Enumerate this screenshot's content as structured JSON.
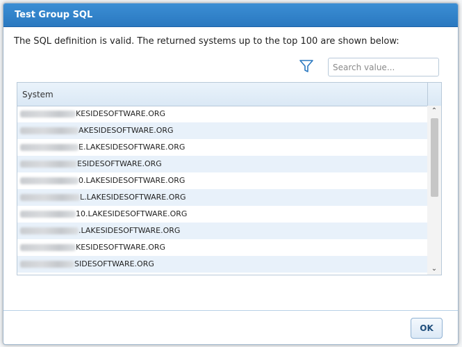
{
  "dialog": {
    "title": "Test Group SQL",
    "message": "The SQL definition is valid. The returned systems up to the top 100 are shown below:",
    "search_placeholder": "Search value...",
    "column_header": "System",
    "ok_label": "OK",
    "filter_icon": "filter-icon",
    "rows": [
      {
        "visible_suffix": "KESIDESOFTWARE.ORG"
      },
      {
        "visible_suffix": "AKESIDESOFTWARE.ORG"
      },
      {
        "visible_suffix": "E.LAKESIDESOFTWARE.ORG"
      },
      {
        "visible_suffix": "ESIDESOFTWARE.ORG"
      },
      {
        "visible_suffix": "0.LAKESIDESOFTWARE.ORG"
      },
      {
        "visible_suffix": "L.LAKESIDESOFTWARE.ORG"
      },
      {
        "visible_suffix": "10.LAKESIDESOFTWARE.ORG"
      },
      {
        "visible_suffix": ".LAKESIDESOFTWARE.ORG"
      },
      {
        "visible_suffix": "KESIDESOFTWARE.ORG"
      },
      {
        "visible_suffix": "SIDESOFTWARE.ORG"
      }
    ]
  },
  "colors": {
    "titlebar": "#2a78c0",
    "row_alt": "#e8f1fa"
  }
}
